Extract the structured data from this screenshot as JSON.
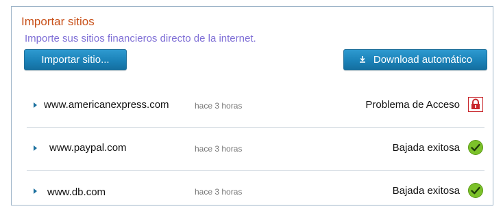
{
  "header": {
    "title": "Importar sitios",
    "subtitle": "Importe sus sitios financieros directo de la internet."
  },
  "toolbar": {
    "import_label": "Importar sitio...",
    "download_label": "Download automático"
  },
  "sites": [
    {
      "url": "www.americanexpress.com",
      "time": "hace 3 horas",
      "status": "Problema de Acceso",
      "icon": "lock-icon"
    },
    {
      "url": "www.paypal.com",
      "time": "hace 3 horas",
      "status": "Bajada exitosa",
      "icon": "check-icon"
    },
    {
      "url": "www.db.com",
      "time": "hace 3 horas",
      "status": "Bajada exitosa",
      "icon": "check-icon"
    }
  ],
  "colors": {
    "title": "#c8511a",
    "subtitle": "#7f6fd6",
    "button": "#1b82b8",
    "error": "#c8262b",
    "success": "#7cc22a"
  }
}
